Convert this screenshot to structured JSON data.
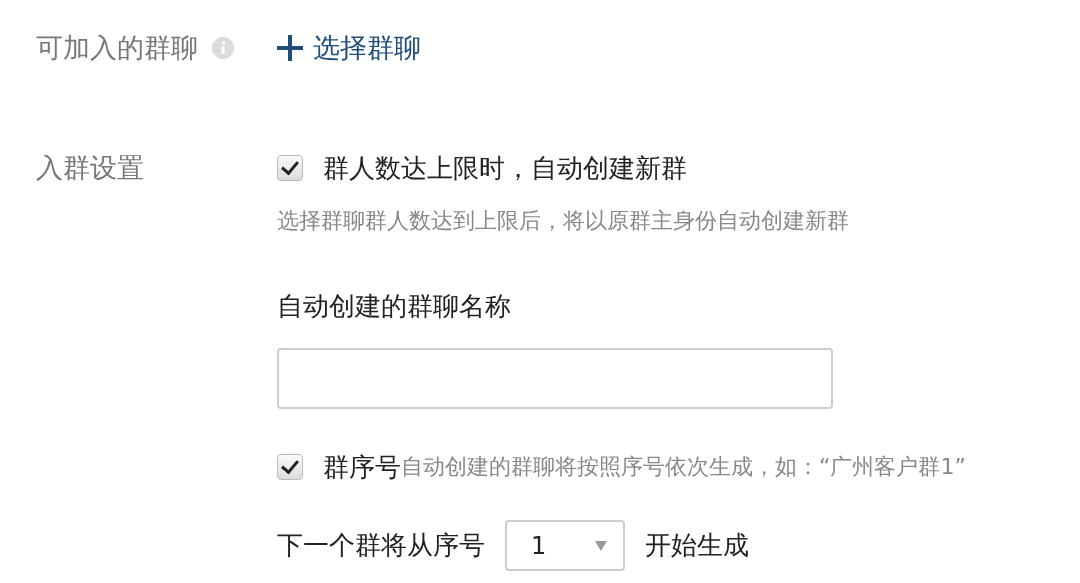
{
  "joinable_groups": {
    "label": "可加入的群聊",
    "action": "选择群聊"
  },
  "join_settings": {
    "label": "入群设置",
    "auto_create": {
      "checked": true,
      "label": "群人数达上限时，自动创建新群",
      "hint": "选择群聊群人数达到上限后，将以原群主身份自动创建新群"
    },
    "name_field": {
      "label": "自动创建的群聊名称"
    },
    "sequence": {
      "checked": true,
      "label": "群序号",
      "hint": "自动创建的群聊将按照序号依次生成，如：“广州客户群1”"
    },
    "start_from": {
      "before": "下一个群将从序号",
      "value": "1",
      "after": "开始生成"
    }
  }
}
